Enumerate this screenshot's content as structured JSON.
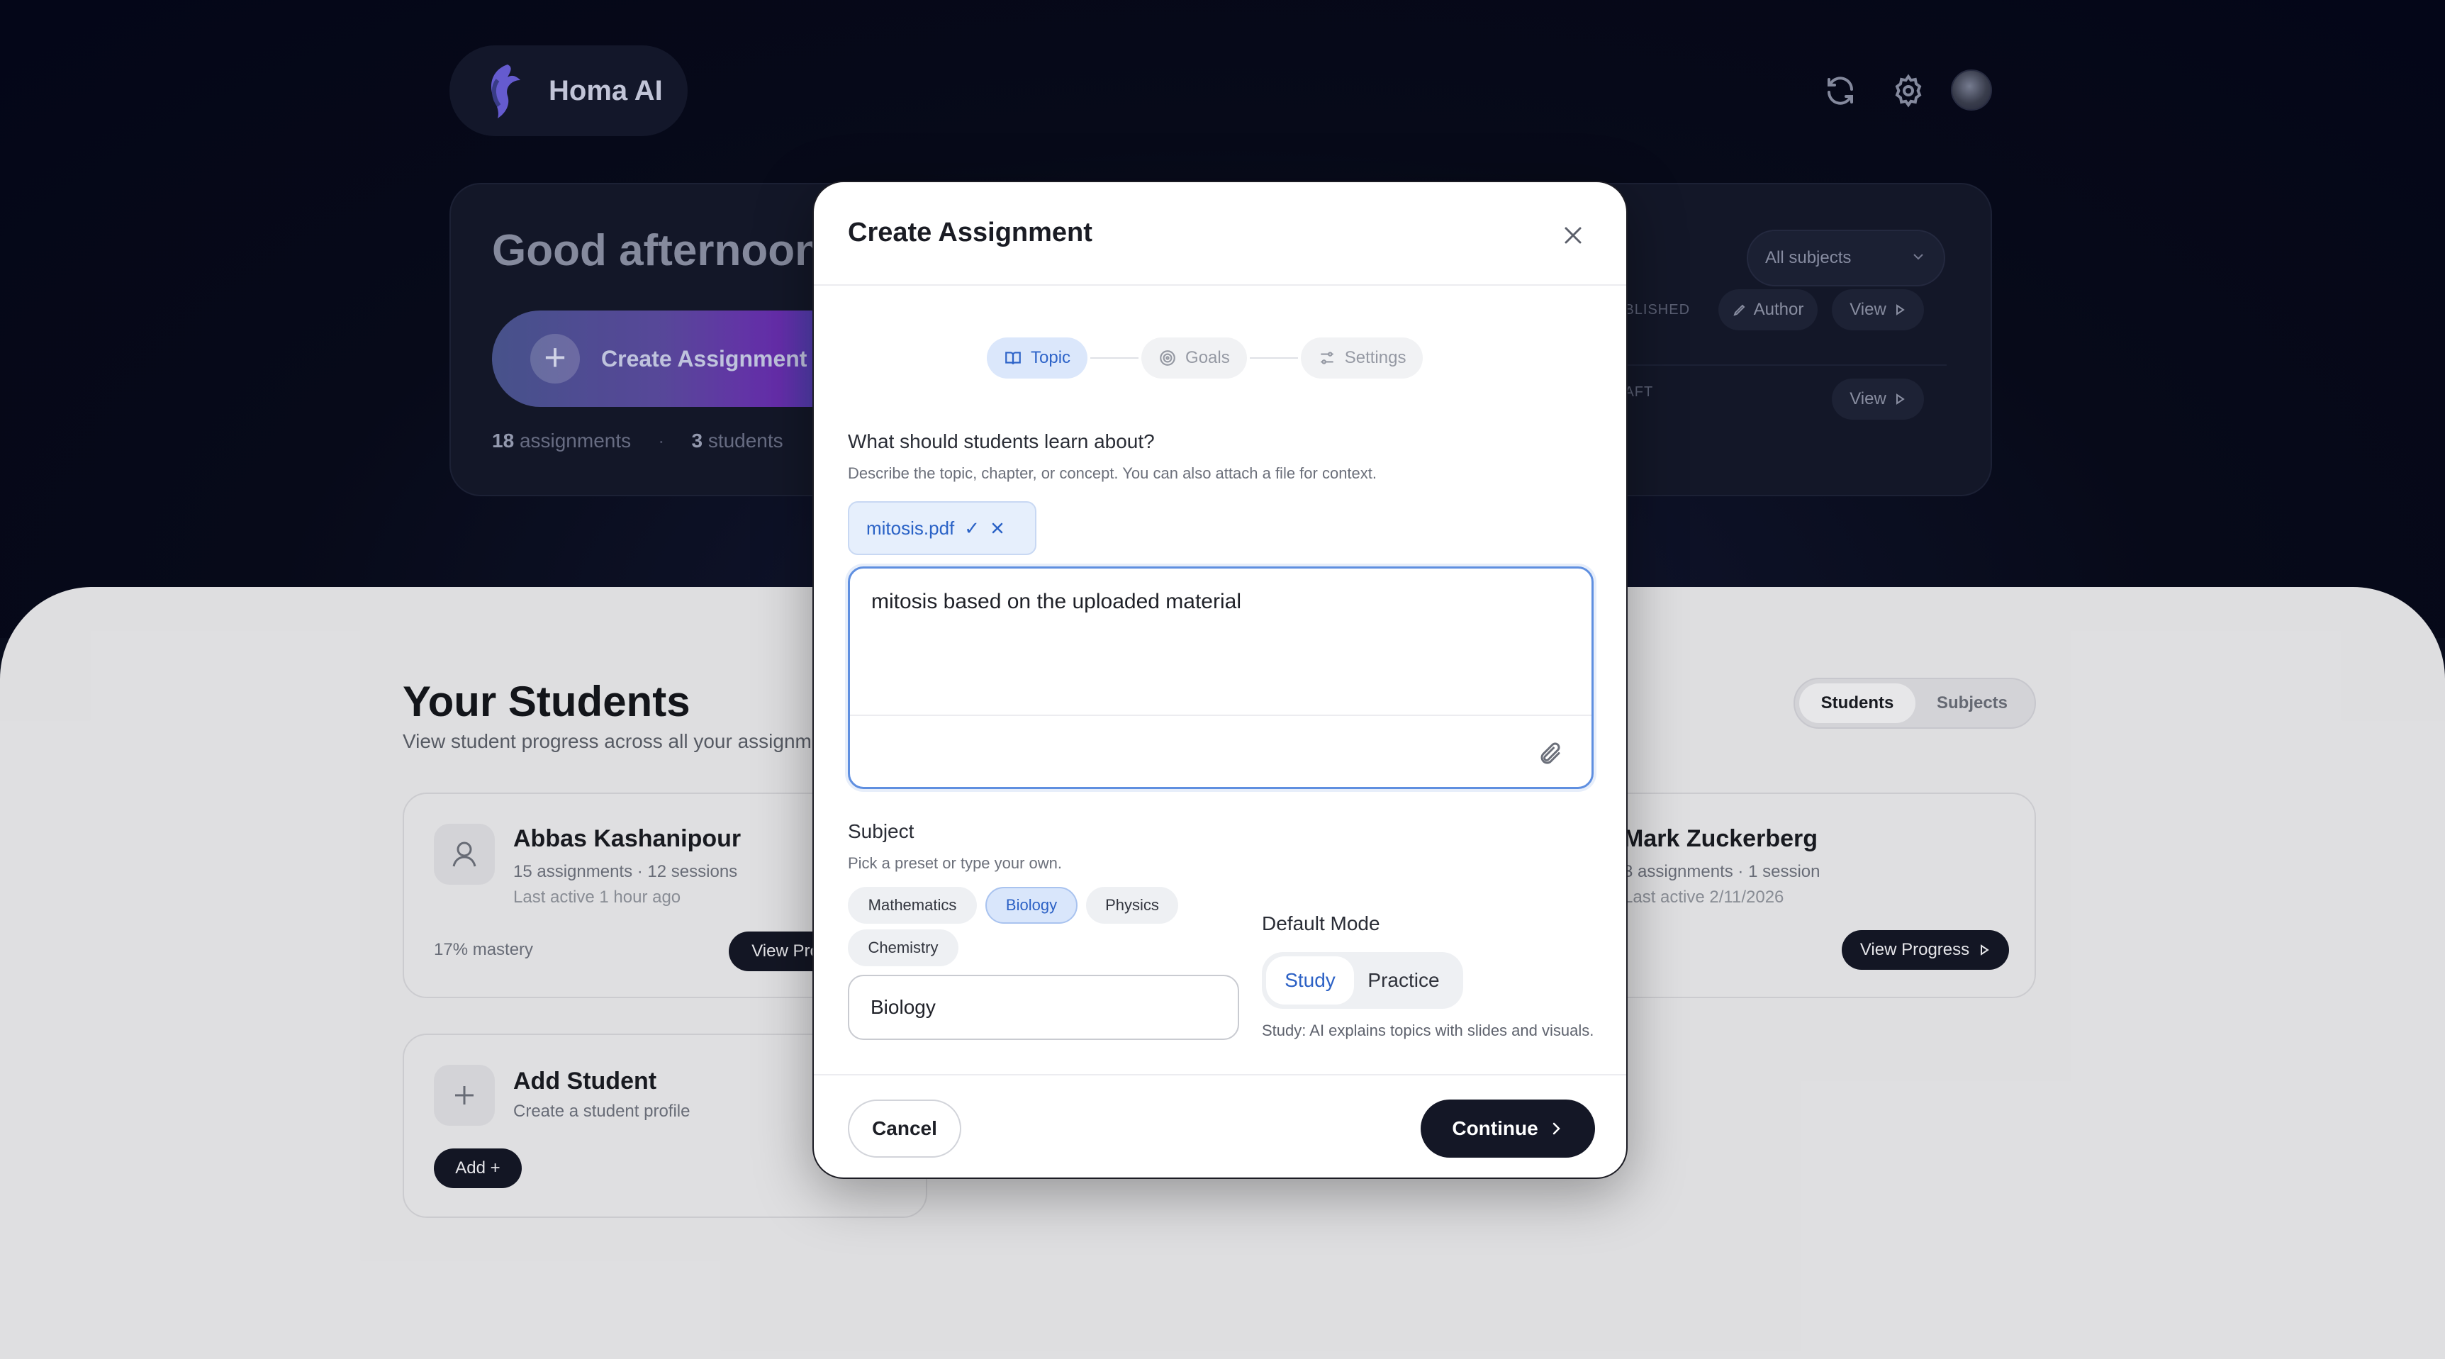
{
  "brand": {
    "name": "Homa AI"
  },
  "hero": {
    "greeting": "Good afternoon",
    "create_label": "Create Assignment",
    "assignments_count": "18",
    "assignments_word": "assignments",
    "students_count": "3",
    "students_word": "students"
  },
  "filter": {
    "subject_select": "All subjects"
  },
  "assignment_rows": [
    {
      "status": "UBLISHED",
      "author_label": "Author",
      "view_label": "View"
    },
    {
      "status": "RAFT",
      "view_label": "View"
    }
  ],
  "students_section": {
    "title": "Your Students",
    "subtitle": "View student progress across all your assignm",
    "tabs": [
      "Students",
      "Subjects"
    ]
  },
  "students": [
    {
      "name": "Abbas Kashanipour",
      "meta": "15 assignments · 12 sessions",
      "last_active": "Last active 1 hour ago",
      "mastery": "17% mastery",
      "button": "View Pro"
    },
    {
      "name": "Mark Zuckerberg",
      "meta": "3 assignments · 1 session",
      "last_active": "Last active 2/11/2026",
      "button": "View Progress"
    }
  ],
  "add_student": {
    "title": "Add Student",
    "subtitle": "Create a student profile",
    "button": "Add +"
  },
  "modal": {
    "title": "Create Assignment",
    "steps": [
      {
        "label": "Topic",
        "icon": "book-icon",
        "active": true
      },
      {
        "label": "Goals",
        "icon": "target-icon",
        "active": false
      },
      {
        "label": "Settings",
        "icon": "sliders-icon",
        "active": false
      }
    ],
    "question": "What should students learn about?",
    "question_help": "Describe the topic, chapter, or concept. You can also attach a file for context.",
    "file_chip": {
      "name": "mitosis.pdf",
      "check": "✓"
    },
    "topic_text": "mitosis based on the uploaded material",
    "subject_label": "Subject",
    "subject_help": "Pick a preset or type your own.",
    "subject_presets": [
      "Mathematics",
      "Biology",
      "Physics",
      "Chemistry"
    ],
    "selected_subject": "Biology",
    "subject_input_value": "Biology",
    "mode_label": "Default Mode",
    "modes": [
      "Study",
      "Practice"
    ],
    "selected_mode": "Study",
    "mode_help": "Study: AI explains topics with slides and visuals.",
    "cancel_label": "Cancel",
    "continue_label": "Continue"
  },
  "colors": {
    "accent": "#2c61c5",
    "dark_button": "#141726",
    "chip_selected_bg": "#d9e6fb"
  }
}
